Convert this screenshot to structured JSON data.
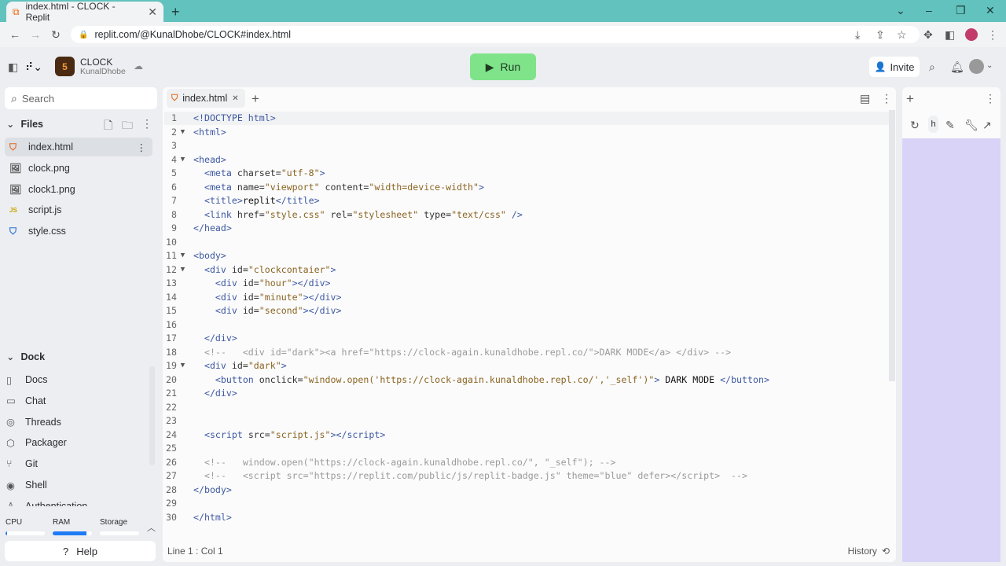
{
  "browser": {
    "tab_title": "index.html - CLOCK - Replit",
    "url": "replit.com/@KunalDhobe/CLOCK#index.html"
  },
  "header": {
    "repl_name": "CLOCK",
    "owner": "KunalDhobe",
    "run_label": "Run",
    "invite_label": "Invite"
  },
  "sidebar": {
    "search_placeholder": "Search",
    "files_label": "Files",
    "files": [
      {
        "name": "index.html",
        "icon": "html-icon"
      },
      {
        "name": "clock.png",
        "icon": "image-icon"
      },
      {
        "name": "clock1.png",
        "icon": "image-icon"
      },
      {
        "name": "script.js",
        "icon": "js-icon"
      },
      {
        "name": "style.css",
        "icon": "css-icon"
      }
    ],
    "dock_label": "Dock",
    "dock": [
      "Docs",
      "Chat",
      "Threads",
      "Packager",
      "Git",
      "Shell",
      "Authentication"
    ],
    "resources": {
      "cpu_label": "CPU",
      "ram_label": "RAM",
      "storage_label": "Storage",
      "cpu": 0.03,
      "ram": 0.85,
      "storage": 0.0
    },
    "help_label": "Help"
  },
  "editor": {
    "tab": "index.html",
    "status": "Line 1 : Col 1",
    "history_label": "History",
    "lines": [
      [
        [
          "t",
          "<!DOCTYPE html>"
        ]
      ],
      [
        [
          "t",
          "<html>"
        ]
      ],
      [],
      [
        [
          "t",
          "<head>"
        ]
      ],
      [
        [
          "x",
          "  "
        ],
        [
          "t",
          "<meta "
        ],
        [
          "a",
          "charset="
        ],
        [
          "s",
          "\"utf-8\""
        ],
        [
          "t",
          ">"
        ]
      ],
      [
        [
          "x",
          "  "
        ],
        [
          "t",
          "<meta "
        ],
        [
          "a",
          "name="
        ],
        [
          "s",
          "\"viewport\""
        ],
        [
          "a",
          " content="
        ],
        [
          "s",
          "\"width=device-width\""
        ],
        [
          "t",
          ">"
        ]
      ],
      [
        [
          "x",
          "  "
        ],
        [
          "t",
          "<title>"
        ],
        [
          "x",
          "replit"
        ],
        [
          "t",
          "</title>"
        ]
      ],
      [
        [
          "x",
          "  "
        ],
        [
          "t",
          "<link "
        ],
        [
          "a",
          "href="
        ],
        [
          "s",
          "\"style.css\""
        ],
        [
          "a",
          " rel="
        ],
        [
          "s",
          "\"stylesheet\""
        ],
        [
          "a",
          " type="
        ],
        [
          "s",
          "\"text/css\""
        ],
        [
          "t",
          " />"
        ]
      ],
      [
        [
          "t",
          "</head>"
        ]
      ],
      [],
      [
        [
          "t",
          "<body>"
        ]
      ],
      [
        [
          "x",
          "  "
        ],
        [
          "t",
          "<div "
        ],
        [
          "a",
          "id="
        ],
        [
          "s",
          "\"clockcontaier\""
        ],
        [
          "t",
          ">"
        ]
      ],
      [
        [
          "x",
          "    "
        ],
        [
          "t",
          "<div "
        ],
        [
          "a",
          "id="
        ],
        [
          "s",
          "\"hour\""
        ],
        [
          "t",
          "></div>"
        ]
      ],
      [
        [
          "x",
          "    "
        ],
        [
          "t",
          "<div "
        ],
        [
          "a",
          "id="
        ],
        [
          "s",
          "\"minute\""
        ],
        [
          "t",
          "></div>"
        ]
      ],
      [
        [
          "x",
          "    "
        ],
        [
          "t",
          "<div "
        ],
        [
          "a",
          "id="
        ],
        [
          "s",
          "\"second\""
        ],
        [
          "t",
          "></div>"
        ]
      ],
      [],
      [
        [
          "x",
          "  "
        ],
        [
          "t",
          "</div>"
        ]
      ],
      [
        [
          "x",
          "  "
        ],
        [
          "c",
          "<!--   <div id=\"dark\"><a href=\"https://clock-again.kunaldhobe.repl.co/\">DARK MODE</a> </div> -->"
        ]
      ],
      [
        [
          "x",
          "  "
        ],
        [
          "t",
          "<div "
        ],
        [
          "a",
          "id="
        ],
        [
          "s",
          "\"dark\""
        ],
        [
          "t",
          ">"
        ]
      ],
      [
        [
          "x",
          "    "
        ],
        [
          "t",
          "<button "
        ],
        [
          "a",
          "onclick="
        ],
        [
          "s",
          "\"window.open('https://clock-again.kunaldhobe.repl.co/','_self')\""
        ],
        [
          "t",
          ">"
        ],
        [
          "x",
          " DARK MODE "
        ],
        [
          "t",
          "</button>"
        ]
      ],
      [
        [
          "x",
          "  "
        ],
        [
          "t",
          "</div>"
        ]
      ],
      [],
      [],
      [
        [
          "x",
          "  "
        ],
        [
          "t",
          "<script "
        ],
        [
          "a",
          "src="
        ],
        [
          "s",
          "\"script.js\""
        ],
        [
          "t",
          "></script>"
        ]
      ],
      [],
      [
        [
          "x",
          "  "
        ],
        [
          "c",
          "<!--   window.open(\"https://clock-again.kunaldhobe.repl.co/\", \"_self\"); -->"
        ]
      ],
      [
        [
          "x",
          "  "
        ],
        [
          "c",
          "<!--   <script src=\"https://replit.com/public/js/replit-badge.js\" theme=\"blue\" defer></script>  -->"
        ]
      ],
      [
        [
          "t",
          "</body>"
        ]
      ],
      [],
      [
        [
          "t",
          "</html>"
        ]
      ]
    ],
    "foldable": [
      2,
      4,
      11,
      12,
      19
    ]
  },
  "preview": {
    "address_char": "h"
  }
}
